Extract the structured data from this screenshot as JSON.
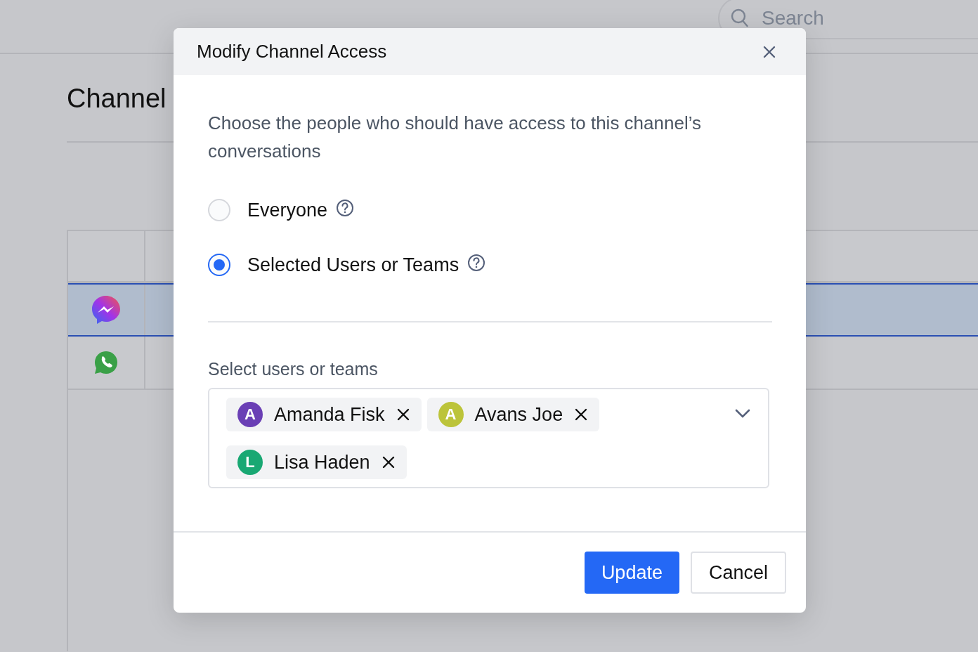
{
  "search": {
    "placeholder": "Search"
  },
  "page": {
    "title": "Channel"
  },
  "table": {
    "rows": [
      {
        "kind": "messenger",
        "selected": true
      },
      {
        "kind": "whatsapp",
        "selected": false
      }
    ]
  },
  "dialog": {
    "title": "Modify Channel Access",
    "description": "Choose the people who should have access to this channel’s conversations",
    "options": [
      {
        "label": "Everyone",
        "selected": false
      },
      {
        "label": "Selected Users or Teams",
        "selected": true
      }
    ],
    "select_label": "Select users or teams",
    "chips": [
      {
        "initial": "A",
        "name": "Amanda Fisk",
        "color": "#6a3fb5"
      },
      {
        "initial": "A",
        "name": "Avans Joe",
        "color": "#bcc43a"
      },
      {
        "initial": "L",
        "name": "Lisa Haden",
        "color": "#19a873"
      }
    ],
    "buttons": [
      {
        "label": "Update",
        "kind": "primary"
      },
      {
        "label": "Cancel",
        "kind": "secondary"
      }
    ]
  }
}
